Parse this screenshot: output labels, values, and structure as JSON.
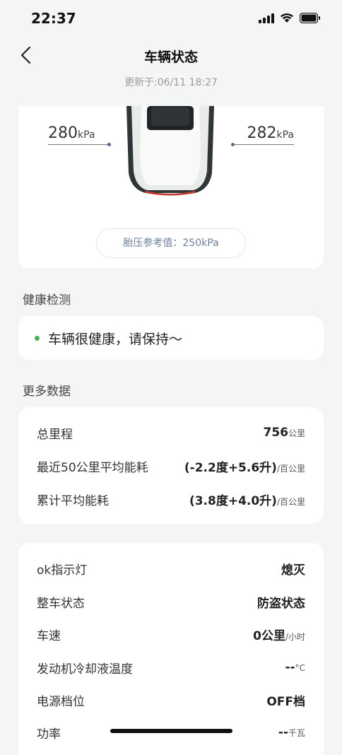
{
  "status_bar": {
    "time": "22:37"
  },
  "header": {
    "title": "车辆状态",
    "updated": "更新于:06/11 18:27"
  },
  "tire": {
    "left_value": "280",
    "left_unit": "kPa",
    "right_value": "282",
    "right_unit": "kPa",
    "reference": "胎压参考值：250kPa"
  },
  "health": {
    "section_label": "健康检测",
    "message": "车辆很健康，请保持～"
  },
  "more_data": {
    "section_label": "更多数据",
    "rows": [
      {
        "label": "总里程",
        "value": "756",
        "unit": "公里"
      },
      {
        "label": "最近50公里平均能耗",
        "value": "(-2.2度+5.6升)",
        "unit": "/百公里"
      },
      {
        "label": "累计平均能耗",
        "value": "(3.8度+4.0升)",
        "unit": "/百公里"
      }
    ]
  },
  "vehicle_status": {
    "rows": [
      {
        "label": "ok指示灯",
        "value": "熄灭",
        "unit": ""
      },
      {
        "label": "整车状态",
        "value": "防盗状态",
        "unit": ""
      },
      {
        "label": "车速",
        "value": "0公里",
        "unit": "/小时"
      },
      {
        "label": "发动机冷却液温度",
        "value": "--",
        "unit": "°C"
      },
      {
        "label": "电源档位",
        "value": "OFF档",
        "unit": ""
      },
      {
        "label": "功率",
        "value": "--",
        "unit": "千瓦"
      }
    ]
  },
  "colors": {
    "health_dot": "#4caf50",
    "accent_text": "#6b7f99"
  }
}
